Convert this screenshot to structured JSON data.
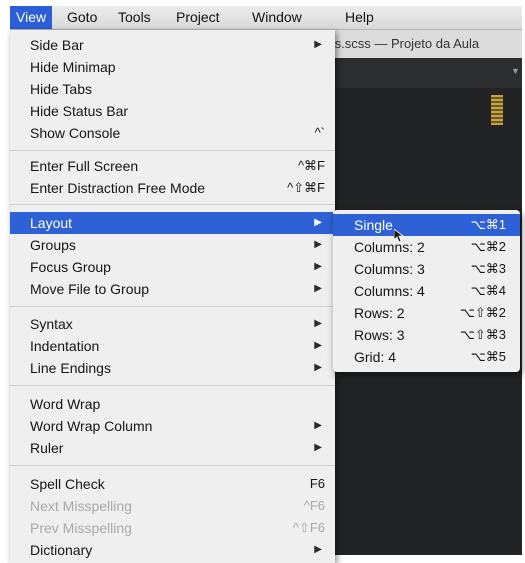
{
  "menubar": {
    "items": [
      "View",
      "Goto",
      "Tools",
      "Project",
      "Window",
      "Help"
    ]
  },
  "window": {
    "title": "tilos.scss — Projeto da Aula"
  },
  "view_menu": {
    "items": [
      {
        "label": "Side Bar",
        "shortcut": "",
        "submenu": true
      },
      {
        "label": "Hide Minimap",
        "shortcut": ""
      },
      {
        "label": "Hide Tabs",
        "shortcut": ""
      },
      {
        "label": "Hide Status Bar",
        "shortcut": ""
      },
      {
        "label": "Show Console",
        "shortcut": "^`"
      },
      {
        "label": "Enter Full Screen",
        "shortcut": "^⌘F"
      },
      {
        "label": "Enter Distraction Free Mode",
        "shortcut": "^⇧⌘F"
      },
      {
        "label": "Layout",
        "shortcut": "",
        "submenu": true,
        "highlighted": true
      },
      {
        "label": "Groups",
        "shortcut": "",
        "submenu": true
      },
      {
        "label": "Focus Group",
        "shortcut": "",
        "submenu": true
      },
      {
        "label": "Move File to Group",
        "shortcut": "",
        "submenu": true
      },
      {
        "label": "Syntax",
        "shortcut": "",
        "submenu": true
      },
      {
        "label": "Indentation",
        "shortcut": "",
        "submenu": true
      },
      {
        "label": "Line Endings",
        "shortcut": "",
        "submenu": true
      },
      {
        "label": "Word Wrap",
        "shortcut": ""
      },
      {
        "label": "Word Wrap Column",
        "shortcut": "",
        "submenu": true
      },
      {
        "label": "Ruler",
        "shortcut": "",
        "submenu": true
      },
      {
        "label": "Spell Check",
        "shortcut": "F6"
      },
      {
        "label": "Next Misspelling",
        "shortcut": "^F6",
        "disabled": true
      },
      {
        "label": "Prev Misspelling",
        "shortcut": "^⇧F6",
        "disabled": true
      },
      {
        "label": "Dictionary",
        "shortcut": "",
        "submenu": true
      }
    ]
  },
  "layout_submenu": {
    "items": [
      {
        "label": "Single",
        "shortcut": "⌥⌘1",
        "highlighted": true
      },
      {
        "label": "Columns: 2",
        "shortcut": "⌥⌘2"
      },
      {
        "label": "Columns: 3",
        "shortcut": "⌥⌘3"
      },
      {
        "label": "Columns: 4",
        "shortcut": "⌥⌘4"
      },
      {
        "label": "Rows: 2",
        "shortcut": "⌥⇧⌘2"
      },
      {
        "label": "Rows: 3",
        "shortcut": "⌥⇧⌘3"
      },
      {
        "label": "Grid: 4",
        "shortcut": "⌥⌘5"
      }
    ]
  },
  "icons": {
    "submenu_arrow": "submenu-arrow-icon",
    "tab_overflow": "tab-overflow-icon",
    "cursor": "mouse-pointer-icon"
  },
  "colors": {
    "highlight": "#2f61d6",
    "menu_background": "#efefef",
    "editor_background": "#222324"
  }
}
